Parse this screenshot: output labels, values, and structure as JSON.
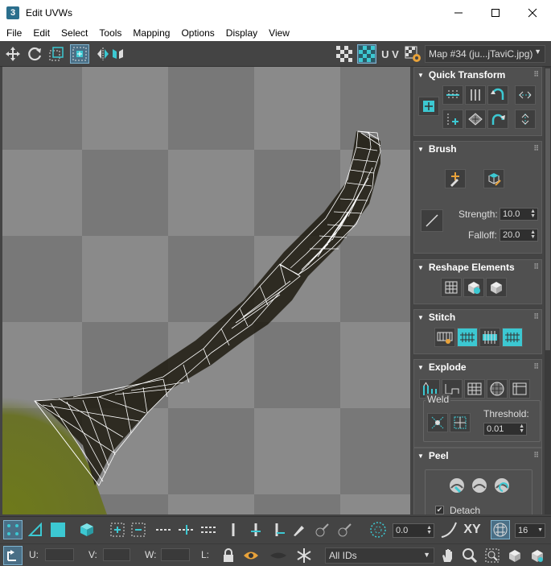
{
  "window": {
    "title": "Edit UVWs",
    "app_icon": "3",
    "controls": [
      "minimize-icon",
      "maximize-icon",
      "close-icon"
    ]
  },
  "menu": [
    "File",
    "Edit",
    "Select",
    "Tools",
    "Mapping",
    "Options",
    "Display",
    "View"
  ],
  "toolbar": {
    "uv_label": "U V",
    "map_select": "Map #34 (ju...jTaviC.jpg)"
  },
  "panel": {
    "quick_transform": {
      "title": "Quick Transform"
    },
    "brush": {
      "title": "Brush",
      "strength_label": "Strength:",
      "strength": "10.0",
      "falloff_label": "Falloff:",
      "falloff": "20.0"
    },
    "reshape": {
      "title": "Reshape Elements"
    },
    "stitch": {
      "title": "Stitch"
    },
    "explode": {
      "title": "Explode",
      "weld_label": "Weld",
      "threshold_label": "Threshold:",
      "threshold": "0.01"
    },
    "peel": {
      "title": "Peel",
      "detach_label": "Detach",
      "detach_checked": true
    }
  },
  "bottom": {
    "angle_value": "0.0",
    "xy_label": "XY",
    "grid_value": "16",
    "u_label": "U:",
    "v_label": "V:",
    "w_label": "W:",
    "l_label": "L:",
    "ids_select": "All IDs"
  },
  "colors": {
    "accent": "#3cc8d2",
    "active_bg": "#4a6f86",
    "panel_bg": "#444444",
    "checker_light": "#8c8c8c",
    "checker_dark": "#7a7a7a"
  }
}
